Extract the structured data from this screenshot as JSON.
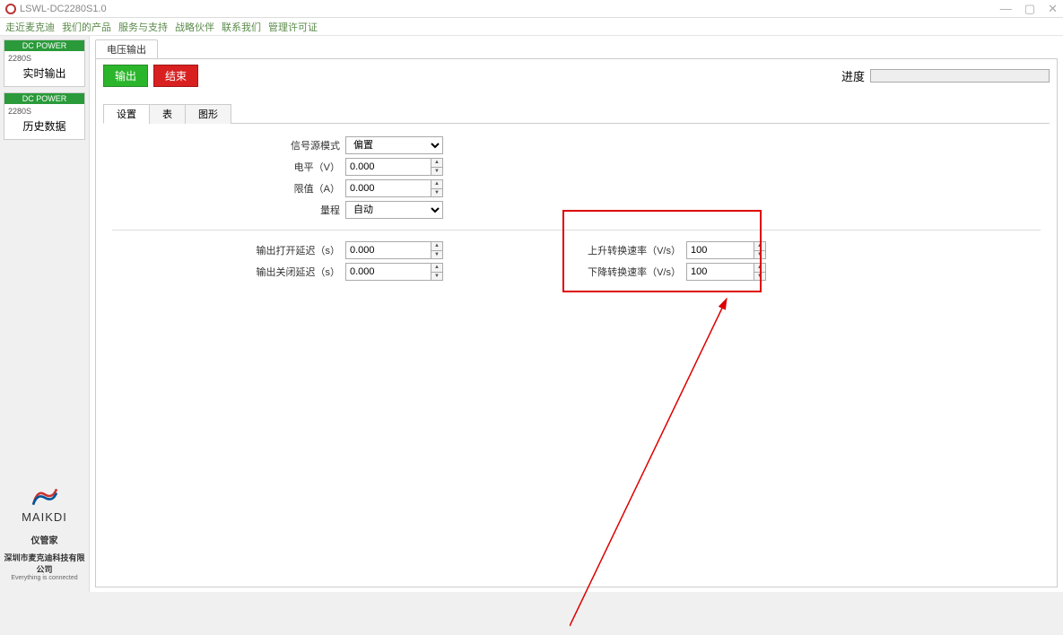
{
  "window": {
    "title": "LSWL-DC2280S1.0"
  },
  "menu": {
    "items": [
      "走近麦克迪",
      "我们的产品",
      "服务与支持",
      "战略伙伴",
      "联系我们",
      "管理许可证"
    ]
  },
  "sidebar": {
    "cards": [
      {
        "header": "DC POWER",
        "model": "2280S",
        "label": "实时输出"
      },
      {
        "header": "DC POWER",
        "model": "2280S",
        "label": "历史数据"
      }
    ],
    "brand": {
      "name": "MAIKDI",
      "sub": "仪管家",
      "company": "深圳市麦克迪科技有限公司",
      "tag": "Everything is connected"
    }
  },
  "content": {
    "main_tab": "电压输出",
    "buttons": {
      "output": "输出",
      "end": "结束"
    },
    "progress_label": "进度",
    "inner_tabs": [
      "设置",
      "表",
      "图形"
    ],
    "form": {
      "signal_mode": {
        "label": "信号源模式",
        "value": "偏置"
      },
      "level": {
        "label": "电平（V）",
        "value": "0.000"
      },
      "limit": {
        "label": "限值（A）",
        "value": "0.000"
      },
      "range": {
        "label": "量程",
        "value": "自动"
      },
      "open_delay": {
        "label": "输出打开延迟（s）",
        "value": "0.000"
      },
      "close_delay": {
        "label": "输出关闭延迟（s）",
        "value": "0.000"
      },
      "rise_rate": {
        "label": "上升转换速率（V/s）",
        "value": "100"
      },
      "fall_rate": {
        "label": "下降转换速率（V/s）",
        "value": "100"
      }
    }
  }
}
